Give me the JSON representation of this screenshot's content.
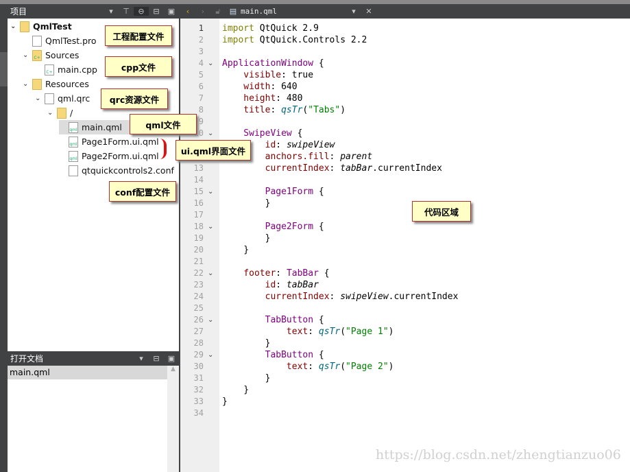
{
  "project_panel": {
    "title": "项目",
    "icons": [
      "dropdown-icon",
      "filter-icon",
      "link-icon",
      "split-icon",
      "close-panel-icon"
    ]
  },
  "tree": [
    {
      "label": "QmlTest",
      "level": 0,
      "arrow": true,
      "icon": "qt-project-icon",
      "bold": true
    },
    {
      "label": "QmlTest.pro",
      "level": 1,
      "arrow": false,
      "icon": "pro-file-icon"
    },
    {
      "label": "Sources",
      "level": 1,
      "arrow": true,
      "icon": "cpp-folder-icon"
    },
    {
      "label": "main.cpp",
      "level": 2,
      "arrow": false,
      "icon": "cpp-file-icon"
    },
    {
      "label": "Resources",
      "level": 1,
      "arrow": true,
      "icon": "resources-folder-icon"
    },
    {
      "label": "qml.qrc",
      "level": 2,
      "arrow": true,
      "icon": "qrc-file-icon"
    },
    {
      "label": "/",
      "level": 3,
      "arrow": true,
      "icon": "folder-icon"
    },
    {
      "label": "main.qml",
      "level": 4,
      "arrow": false,
      "icon": "qml-file-icon",
      "selected": true
    },
    {
      "label": "Page1Form.ui.qml",
      "level": 4,
      "arrow": false,
      "icon": "qml-file-icon"
    },
    {
      "label": "Page2Form.ui.qml",
      "level": 4,
      "arrow": false,
      "icon": "qml-file-icon"
    },
    {
      "label": "qtquickcontrols2.conf",
      "level": 4,
      "arrow": false,
      "icon": "file-icon"
    }
  ],
  "open_docs": {
    "title": "打开文档",
    "items": [
      "main.qml"
    ]
  },
  "editor": {
    "filename": "main.qml",
    "current_line": 1,
    "folds": [
      4,
      10,
      15,
      18,
      22,
      26,
      29
    ],
    "lines": [
      [
        [
          "import ",
          "kw"
        ],
        [
          "QtQuick 2.9",
          ""
        ]
      ],
      [
        [
          "import ",
          "kw"
        ],
        [
          "QtQuick.Controls 2.2",
          ""
        ]
      ],
      [],
      [
        [
          "ApplicationWindow",
          "ty"
        ],
        [
          " {",
          ""
        ]
      ],
      [
        [
          "    visible",
          "pr"
        ],
        [
          ": true",
          ""
        ]
      ],
      [
        [
          "    width",
          "pr"
        ],
        [
          ": 640",
          ""
        ]
      ],
      [
        [
          "    height",
          "pr"
        ],
        [
          ": 480",
          ""
        ]
      ],
      [
        [
          "    title",
          "pr"
        ],
        [
          ": ",
          ""
        ],
        [
          "qsTr",
          "fn"
        ],
        [
          "(",
          ""
        ],
        [
          "\"Tabs\"",
          "st"
        ],
        [
          ")",
          ""
        ]
      ],
      [],
      [
        [
          "    SwipeView",
          "ty"
        ],
        [
          " {",
          ""
        ]
      ],
      [
        [
          "        id",
          "pr"
        ],
        [
          ": ",
          ""
        ],
        [
          "swipeView",
          "it"
        ]
      ],
      [
        [
          "        anchors.fill",
          "pr"
        ],
        [
          ": ",
          ""
        ],
        [
          "parent",
          "it"
        ]
      ],
      [
        [
          "        currentIndex",
          "pr"
        ],
        [
          ": ",
          ""
        ],
        [
          "tabBar",
          "it"
        ],
        [
          ".currentIndex",
          ""
        ]
      ],
      [],
      [
        [
          "        Page1Form",
          "ty"
        ],
        [
          " {",
          ""
        ]
      ],
      [
        [
          "        }",
          ""
        ]
      ],
      [],
      [
        [
          "        Page2Form",
          "ty"
        ],
        [
          " {",
          ""
        ]
      ],
      [
        [
          "        }",
          ""
        ]
      ],
      [
        [
          "    }",
          ""
        ]
      ],
      [],
      [
        [
          "    footer",
          "pr"
        ],
        [
          ": ",
          ""
        ],
        [
          "TabBar",
          "ty"
        ],
        [
          " {",
          ""
        ]
      ],
      [
        [
          "        id",
          "pr"
        ],
        [
          ": ",
          ""
        ],
        [
          "tabBar",
          "it"
        ]
      ],
      [
        [
          "        currentIndex",
          "pr"
        ],
        [
          ": ",
          ""
        ],
        [
          "swipeView",
          "it"
        ],
        [
          ".currentIndex",
          ""
        ]
      ],
      [],
      [
        [
          "        TabButton",
          "ty"
        ],
        [
          " {",
          ""
        ]
      ],
      [
        [
          "            text",
          "pr"
        ],
        [
          ": ",
          ""
        ],
        [
          "qsTr",
          "fn"
        ],
        [
          "(",
          ""
        ],
        [
          "\"Page 1\"",
          "st"
        ],
        [
          ")",
          ""
        ]
      ],
      [
        [
          "        }",
          ""
        ]
      ],
      [
        [
          "        TabButton",
          "ty"
        ],
        [
          " {",
          ""
        ]
      ],
      [
        [
          "            text",
          "pr"
        ],
        [
          ": ",
          ""
        ],
        [
          "qsTr",
          "fn"
        ],
        [
          "(",
          ""
        ],
        [
          "\"Page 2\"",
          "st"
        ],
        [
          ")",
          ""
        ]
      ],
      [
        [
          "        }",
          ""
        ]
      ],
      [
        [
          "    }",
          ""
        ]
      ],
      [
        [
          "}",
          ""
        ]
      ],
      []
    ]
  },
  "annotations": [
    "工程配置文件",
    "cpp文件",
    "qrc资源文件",
    "qml文件",
    "ui.qml界面文件",
    "conf配置文件",
    "代码区域"
  ],
  "watermark": "https://blog.csdn.net/zhengtianzuo06"
}
